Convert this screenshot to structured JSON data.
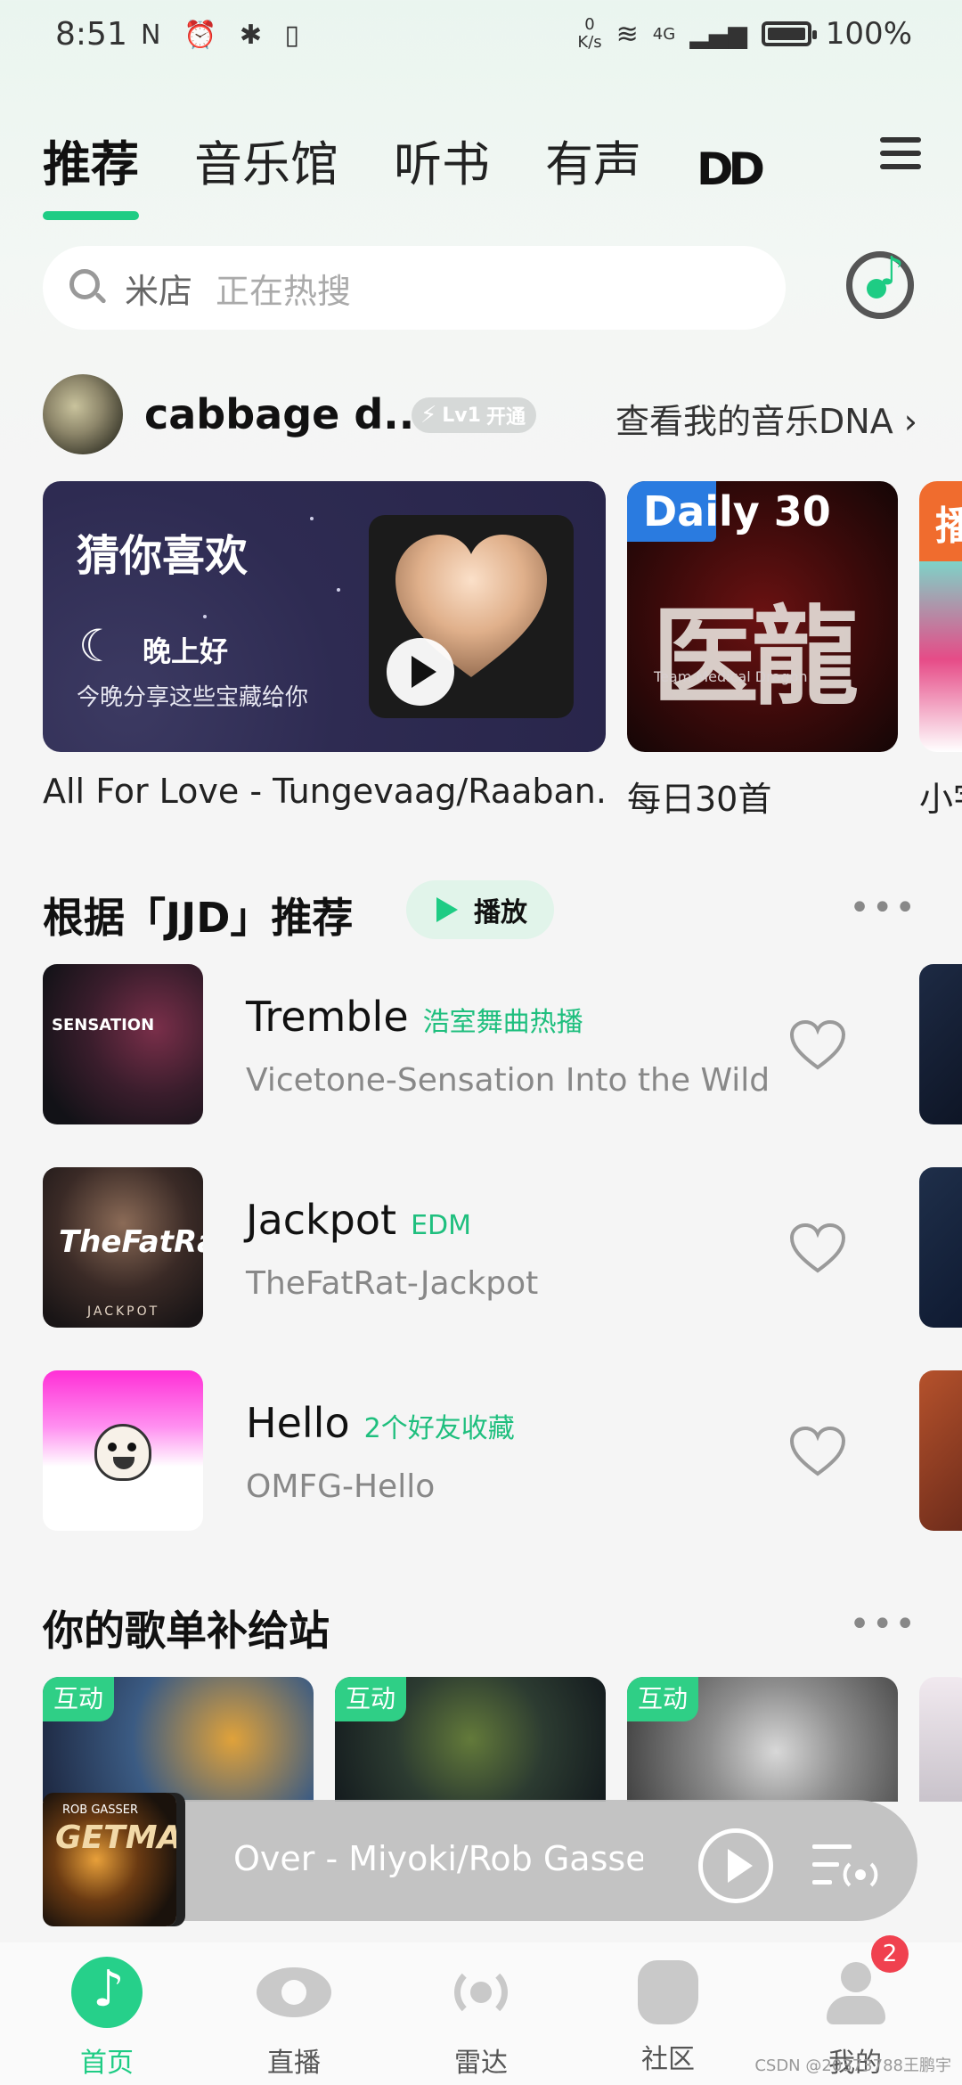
{
  "status_bar": {
    "time": "8:51",
    "icons": "N ⏰ ✱ ▯",
    "net_speed_value": "0",
    "net_speed_unit": "K/s",
    "network": "4G",
    "battery": "100%"
  },
  "tabs": [
    "推荐",
    "音乐馆",
    "听书",
    "有声",
    "DD"
  ],
  "search": {
    "hint": "米店",
    "sub": "正在热搜"
  },
  "user": {
    "name": "cabbage d...",
    "level": "Lv1",
    "level_action": "开通",
    "dna_link": "查看我的音乐DNA ›"
  },
  "banners": {
    "main_title": "猜你喜欢",
    "greeting": "晚上好",
    "greeting_sub": "今晚分享这些宝藏给你",
    "main_caption": "All For Love - Tungevaag/Raaban...",
    "daily_tag": "Daily 30",
    "daily_art": "医龍",
    "daily_art_sub": "Team Medical Dragon",
    "daily_caption": "每日30首",
    "third_tag": "播",
    "third_caption": "小宇"
  },
  "section_recommend": {
    "title": "根据「JJD」推荐",
    "play_label": "播放",
    "more": "•••"
  },
  "songs": [
    {
      "title": "Tremble",
      "tag": "浩室舞曲热播",
      "artist": "Vicetone-Sensation Into the Wild",
      "cover_text": "SENSATION"
    },
    {
      "title": "Jackpot",
      "tag": "EDM",
      "artist": "TheFatRat-Jackpot",
      "cover_text": "TheFatRat",
      "cover_sub": "JACKPOT"
    },
    {
      "title": "Hello",
      "tag": "2个好友收藏",
      "artist": "OMFG-Hello"
    }
  ],
  "section_playlists": {
    "title": "你的歌单补给站",
    "more": "•••",
    "items": [
      {
        "tag": "互动"
      },
      {
        "tag": "互动"
      },
      {
        "tag": "互动"
      }
    ]
  },
  "mini_player": {
    "title": "Over - Miyoki/Rob Gasser",
    "cover_text": "GETMAD",
    "cover_sub": "ROB GASSER"
  },
  "bottom_nav": [
    {
      "label": "首页",
      "icon": "home-music-icon",
      "active": true
    },
    {
      "label": "直播",
      "icon": "eye-icon"
    },
    {
      "label": "雷达",
      "icon": "radar-icon"
    },
    {
      "label": "社区",
      "icon": "community-icon"
    },
    {
      "label": "我的",
      "icon": "profile-icon"
    }
  ],
  "notification_count": "2",
  "watermark": "CSDN @20373788王鹏宇",
  "colors": {
    "accent": "#1ecc84",
    "badge": "#f0414f"
  }
}
